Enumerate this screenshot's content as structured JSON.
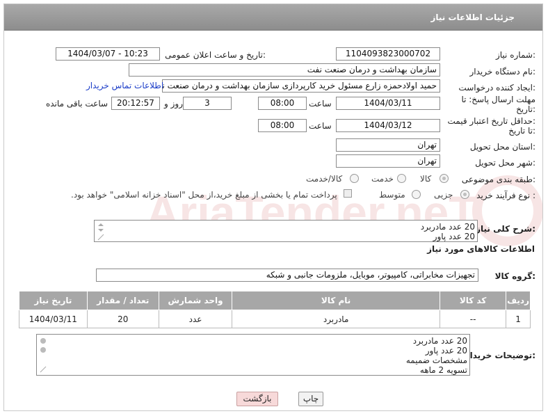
{
  "header": {
    "title": "جزئیات اطلاعات نیاز"
  },
  "form": {
    "need_number": {
      "label": "شماره نیاز:",
      "value": "1104093823000702"
    },
    "announce_datetime": {
      "label": "تاریخ و ساعت اعلان عمومی:",
      "value": "1404/03/07 - 10:23"
    },
    "buyer_org": {
      "label": "نام دستگاه خریدار:",
      "value": "سازمان بهداشت و درمان صنعت نفت"
    },
    "requester": {
      "label": "ایجاد کننده درخواست:",
      "value": "حمید اولادحمزه زارع مسئول خرید کارپردازی سازمان بهداشت و درمان صنعت نفت",
      "contact_link": "اطلاعات تماس خریدار"
    },
    "reply_deadline": {
      "label_line1": "مهلت ارسال پاسخ: تا",
      "label_line2": "تاریخ:",
      "date": "1404/03/11",
      "time_label": "ساعت",
      "time": "08:00",
      "days": "3",
      "days_label": "روز و",
      "remaining": "20:12:57",
      "remaining_label": "ساعت باقی مانده"
    },
    "price_validity": {
      "label_line1": "حداقل تاریخ اعتبار قیمت:",
      "label_line2": "تا تاریخ:",
      "date": "1404/03/12",
      "time_label": "ساعت",
      "time": "08:00"
    },
    "delivery_province": {
      "label": "استان محل تحویل:",
      "value": "تهران"
    },
    "delivery_city": {
      "label": "شهر محل تحویل:",
      "value": "تهران"
    },
    "category": {
      "label": "طبقه بندی موضوعی:",
      "options": [
        "کالا",
        "خدمت",
        "کالا/خدمت"
      ],
      "selected": "کالا"
    },
    "purchase_process": {
      "label": "نوع فرآیند خرید :",
      "options": [
        "جزیی",
        "متوسط"
      ],
      "selected": "جزیی",
      "payment_note": "پرداخت تمام یا بخشی از مبلغ خرید،از محل \"اسناد خزانه اسلامی\" خواهد بود."
    }
  },
  "description": {
    "label": "شرح کلی نیاز:",
    "lines": [
      "20 عدد مادربرد",
      "20 عدد پاور"
    ]
  },
  "goods_section": {
    "title": "اطلاعات کالاهای مورد نیاز",
    "group_label": "گروه کالا:",
    "group_value": "تجهیزات مخابراتی، کامپیوتر، موبایل، ملزومات جانبی و شبکه"
  },
  "table": {
    "headers": [
      "ردیف",
      "کد کالا",
      "نام کالا",
      "واحد شمارش",
      "تعداد / مقدار",
      "تاریخ نیاز"
    ],
    "rows": [
      [
        "1",
        "--",
        "مادربرد",
        "عدد",
        "20",
        "1404/03/11"
      ]
    ]
  },
  "buyer_notes": {
    "label": "توضیحات خریدار:",
    "lines": [
      "20 عدد مادربرد",
      "20 عدد پاور",
      "مشخصات ضمیمه",
      "تسویه 2 ماهه"
    ]
  },
  "buttons": {
    "print": "چاپ",
    "back": "بازگشت"
  },
  "watermark_text": "AriaTender.neT",
  "colors": {
    "header_bg": "#9a9a9a",
    "link": "#1a3cc8",
    "back_button": "#f7d9d9"
  }
}
